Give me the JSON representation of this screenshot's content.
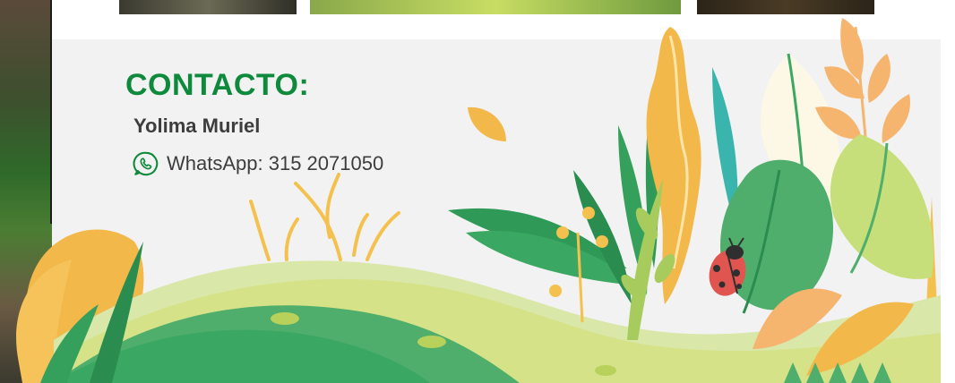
{
  "contact": {
    "title": "CONTACTO:",
    "name": "Yolima Muriel",
    "whatsapp": "WhatsApp: 315 2071050",
    "icon": "whatsapp-icon"
  },
  "colors": {
    "title_green": "#0f8a3c",
    "text_gray": "#3d3d3d",
    "panel_bg": "#f2f2f2"
  }
}
